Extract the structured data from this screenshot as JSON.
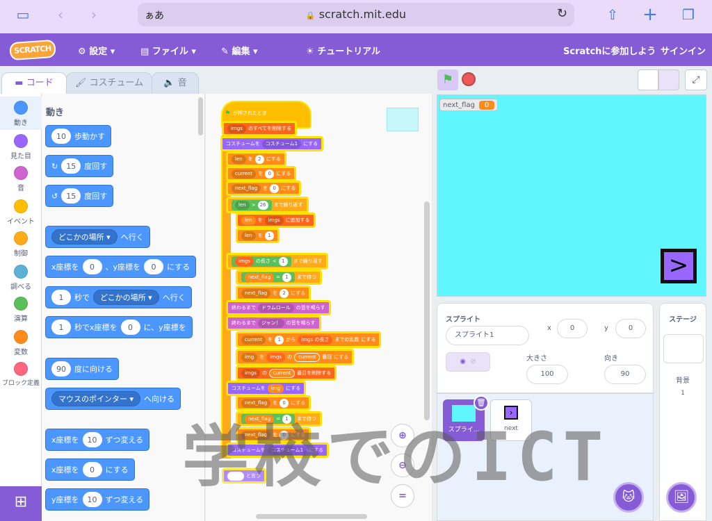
{
  "browser": {
    "address_prefix": "ぁあ",
    "url": "scratch.mit.edu",
    "lock": "🔒"
  },
  "menu": {
    "logo": "SCRATCH",
    "settings": "設定",
    "file": "ファイル",
    "edit": "編集",
    "tutorial": "チュートリアル",
    "join": "Scratchに参加しよう",
    "signin": "サインイン"
  },
  "tabs": {
    "code": "コード",
    "costume": "コスチューム",
    "sound": "音"
  },
  "categories": [
    {
      "label": "動き",
      "color": "#4c97ff"
    },
    {
      "label": "見た目",
      "color": "#9966ff"
    },
    {
      "label": "音",
      "color": "#cf63cf"
    },
    {
      "label": "イベント",
      "color": "#ffbf00"
    },
    {
      "label": "制御",
      "color": "#ffab19"
    },
    {
      "label": "調べる",
      "color": "#5cb1d6"
    },
    {
      "label": "演算",
      "color": "#59c059"
    },
    {
      "label": "変数",
      "color": "#ff8c1a"
    },
    {
      "label": "ブロック定義",
      "color": "#ff6680"
    }
  ],
  "palette": {
    "title": "動き",
    "b1": {
      "v": "10",
      "t": "歩動かす"
    },
    "b2": {
      "v": "15",
      "t": "度回す"
    },
    "b3": {
      "v": "15",
      "t": "度回す"
    },
    "b4": {
      "dd": "どこかの場所",
      "t": "へ行く"
    },
    "b5": {
      "a": "x座標を",
      "v1": "0",
      "b": "、y座標を",
      "v2": "0",
      "c": "にする"
    },
    "b6": {
      "v": "1",
      "a": "秒で",
      "dd": "どこかの場所",
      "t": "へ行く"
    },
    "b7": {
      "v": "1",
      "a": "秒でx座標を",
      "v2": "0",
      "b": "に、y座標を"
    },
    "b8": {
      "v": "90",
      "t": "度に向ける"
    },
    "b9": {
      "dd": "マウスのポインター",
      "t": "へ向ける"
    },
    "b10": {
      "a": "x座標を",
      "v": "10",
      "t": "ずつ変える"
    },
    "b11": {
      "a": "x座標を",
      "v": "0",
      "t": "にする"
    },
    "b12": {
      "a": "y座標を",
      "v": "10",
      "t": "ずつ変える"
    }
  },
  "script": {
    "hat": "が押されたとき",
    "s1": {
      "dd": "imgs",
      "t": "のすべてを削除する"
    },
    "s2": {
      "a": "コスチュームを",
      "dd": "コスチューム1",
      "t": "にする"
    },
    "s3": {
      "dd": "len",
      "a": "を",
      "v": "2",
      "t": "にする"
    },
    "s4": {
      "dd": "current",
      "a": "を",
      "v": "0",
      "t": "にする"
    },
    "s5": {
      "dd": "next_flag",
      "a": "を",
      "v": "0",
      "t": "にする"
    },
    "s6": {
      "a": "len",
      "op": ">",
      "v": "26",
      "t": "まで繰り返す"
    },
    "s7": {
      "a": "len",
      "b": "を",
      "dd": "imgs",
      "t": "に追加する"
    },
    "s8": {
      "dd": "len",
      "a": "を",
      "v": "1",
      "t": "ずつ変える"
    },
    "s9": {
      "dd": "imgs",
      "a": "の長さ",
      "op": "<",
      "v": "1",
      "t": "まで繰り返す"
    },
    "s10": {
      "a": "next_flag",
      "op": "=",
      "v": "1",
      "t": "まで待つ"
    },
    "s11": {
      "dd": "next_flag",
      "a": "を",
      "v": "2",
      "t": "にする"
    },
    "s12": {
      "a": "終わるまで",
      "dd": "ドラムロール",
      "t": "の音を鳴らす"
    },
    "s13": {
      "a": "終わるまで",
      "dd": "ジャン！",
      "t": "の音を鳴らす"
    },
    "s14": {
      "dd": "current",
      "a": "を",
      "v": "1",
      "b": "から",
      "dd2": "imgs",
      "c": "の長さ",
      "d": "までの乱数",
      "t": "にする"
    },
    "s15": {
      "dd": "img",
      "a": "を",
      "dd2": "imgs",
      "b": "の",
      "c": "current",
      "d": "番目",
      "t": "にする"
    },
    "s16": {
      "dd": "imgs",
      "a": "の",
      "c": "current",
      "t": "番目を削除する"
    },
    "s17": {
      "a": "コスチュームを",
      "c": "img",
      "t": "にする"
    },
    "s18": {
      "dd": "next_flag",
      "a": "を",
      "v": "0",
      "t": "にする"
    },
    "s19": {
      "a": "next_flag",
      "op": "=",
      "v": "1",
      "t": "まで待つ"
    },
    "s20": {
      "dd": "next_flag",
      "a": "を",
      "v": "0",
      "t": "にする"
    },
    "s21": {
      "a": "コスチュームを",
      "dd": "コスチューム1",
      "t": "にする"
    },
    "s22": {
      "t": "と言う"
    }
  },
  "stage": {
    "monitor_label": "next_flag",
    "monitor_value": "0",
    "sprite_glyph": ">"
  },
  "sprite_info": {
    "header": "スプライト",
    "name": "スプライト1",
    "x_label": "x",
    "x_value": "0",
    "y_label": "y",
    "y_value": "0",
    "size_label": "大きさ",
    "size_value": "100",
    "dir_label": "向き",
    "dir_value": "90",
    "tile1": "スプライ...",
    "tile2": "next"
  },
  "stage_panel": {
    "header": "ステージ",
    "backdrop_label": "背景",
    "backdrop_count": "1"
  },
  "watermark": "学校でのICT"
}
